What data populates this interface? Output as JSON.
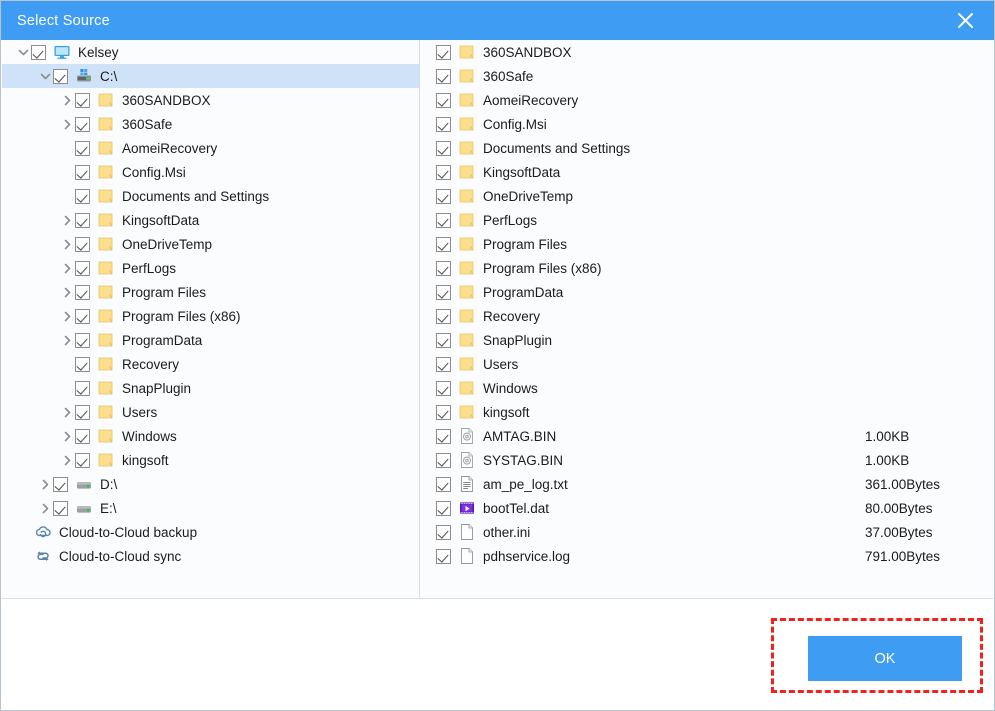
{
  "window": {
    "title": "Select Source",
    "close_label": "close-icon",
    "accent_color": "#3f9cf3",
    "selection_color": "#cfe2f7",
    "focus_outline_color": "#f41f1f"
  },
  "left_tree": {
    "nodes": [
      {
        "label": "Kelsey",
        "icon": "monitor-icon",
        "indent": 0,
        "expander": "expanded",
        "checked": true,
        "selected": false
      },
      {
        "label": "C:\\",
        "icon": "system-drive-icon",
        "indent": 1,
        "expander": "expanded",
        "checked": true,
        "selected": true
      },
      {
        "label": "360SANDBOX",
        "icon": "folder-icon",
        "indent": 2,
        "expander": "collapsed",
        "checked": true,
        "selected": false
      },
      {
        "label": "360Safe",
        "icon": "folder-icon",
        "indent": 2,
        "expander": "collapsed",
        "checked": true,
        "selected": false
      },
      {
        "label": "AomeiRecovery",
        "icon": "folder-icon",
        "indent": 2,
        "expander": "none",
        "checked": true,
        "selected": false
      },
      {
        "label": "Config.Msi",
        "icon": "folder-icon",
        "indent": 2,
        "expander": "none",
        "checked": true,
        "selected": false
      },
      {
        "label": "Documents and Settings",
        "icon": "folder-icon",
        "indent": 2,
        "expander": "none",
        "checked": true,
        "selected": false
      },
      {
        "label": "KingsoftData",
        "icon": "folder-icon",
        "indent": 2,
        "expander": "collapsed",
        "checked": true,
        "selected": false
      },
      {
        "label": "OneDriveTemp",
        "icon": "folder-icon",
        "indent": 2,
        "expander": "collapsed",
        "checked": true,
        "selected": false
      },
      {
        "label": "PerfLogs",
        "icon": "folder-icon",
        "indent": 2,
        "expander": "collapsed",
        "checked": true,
        "selected": false
      },
      {
        "label": "Program Files",
        "icon": "folder-icon",
        "indent": 2,
        "expander": "collapsed",
        "checked": true,
        "selected": false
      },
      {
        "label": "Program Files (x86)",
        "icon": "folder-icon",
        "indent": 2,
        "expander": "collapsed",
        "checked": true,
        "selected": false
      },
      {
        "label": "ProgramData",
        "icon": "folder-icon",
        "indent": 2,
        "expander": "collapsed",
        "checked": true,
        "selected": false
      },
      {
        "label": "Recovery",
        "icon": "folder-icon",
        "indent": 2,
        "expander": "none",
        "checked": true,
        "selected": false
      },
      {
        "label": "SnapPlugin",
        "icon": "folder-icon",
        "indent": 2,
        "expander": "none",
        "checked": true,
        "selected": false
      },
      {
        "label": "Users",
        "icon": "folder-icon",
        "indent": 2,
        "expander": "collapsed",
        "checked": true,
        "selected": false
      },
      {
        "label": "Windows",
        "icon": "folder-icon",
        "indent": 2,
        "expander": "collapsed",
        "checked": true,
        "selected": false
      },
      {
        "label": "kingsoft",
        "icon": "folder-icon",
        "indent": 2,
        "expander": "collapsed",
        "checked": true,
        "selected": false
      },
      {
        "label": "D:\\",
        "icon": "drive-icon",
        "indent": 1,
        "expander": "collapsed",
        "checked": true,
        "selected": false
      },
      {
        "label": "E:\\",
        "icon": "drive-icon",
        "indent": 1,
        "expander": "collapsed",
        "checked": true,
        "selected": false
      }
    ],
    "cloud_entries": [
      {
        "label": "Cloud-to-Cloud backup",
        "icon": "cloud-backup-icon"
      },
      {
        "label": "Cloud-to-Cloud sync",
        "icon": "cloud-sync-icon"
      }
    ]
  },
  "right_list": {
    "items": [
      {
        "name": "360SANDBOX",
        "icon": "folder-icon",
        "size": "",
        "checked": true
      },
      {
        "name": "360Safe",
        "icon": "folder-icon",
        "size": "",
        "checked": true
      },
      {
        "name": "AomeiRecovery",
        "icon": "folder-icon",
        "size": "",
        "checked": true
      },
      {
        "name": "Config.Msi",
        "icon": "folder-icon",
        "size": "",
        "checked": true
      },
      {
        "name": "Documents and Settings",
        "icon": "folder-icon",
        "size": "",
        "checked": true
      },
      {
        "name": "KingsoftData",
        "icon": "folder-icon",
        "size": "",
        "checked": true
      },
      {
        "name": "OneDriveTemp",
        "icon": "folder-icon",
        "size": "",
        "checked": true
      },
      {
        "name": "PerfLogs",
        "icon": "folder-icon",
        "size": "",
        "checked": true
      },
      {
        "name": "Program Files",
        "icon": "folder-icon",
        "size": "",
        "checked": true
      },
      {
        "name": "Program Files (x86)",
        "icon": "folder-icon",
        "size": "",
        "checked": true
      },
      {
        "name": "ProgramData",
        "icon": "folder-icon",
        "size": "",
        "checked": true
      },
      {
        "name": "Recovery",
        "icon": "folder-icon",
        "size": "",
        "checked": true
      },
      {
        "name": "SnapPlugin",
        "icon": "folder-icon",
        "size": "",
        "checked": true
      },
      {
        "name": "Users",
        "icon": "folder-icon",
        "size": "",
        "checked": true
      },
      {
        "name": "Windows",
        "icon": "folder-icon",
        "size": "",
        "checked": true
      },
      {
        "name": "kingsoft",
        "icon": "folder-icon",
        "size": "",
        "checked": true
      },
      {
        "name": "AMTAG.BIN",
        "icon": "disc-file-icon",
        "size": "1.00KB",
        "checked": true
      },
      {
        "name": "SYSTAG.BIN",
        "icon": "disc-file-icon",
        "size": "1.00KB",
        "checked": true
      },
      {
        "name": "am_pe_log.txt",
        "icon": "text-file-icon",
        "size": "361.00Bytes",
        "checked": true
      },
      {
        "name": "bootTel.dat",
        "icon": "media-file-icon",
        "size": "80.00Bytes",
        "checked": true
      },
      {
        "name": "other.ini",
        "icon": "blank-file-icon",
        "size": "37.00Bytes",
        "checked": true
      },
      {
        "name": "pdhservice.log",
        "icon": "blank-file-icon",
        "size": "791.00Bytes",
        "checked": true
      }
    ]
  },
  "footer": {
    "ok_label": "OK"
  }
}
